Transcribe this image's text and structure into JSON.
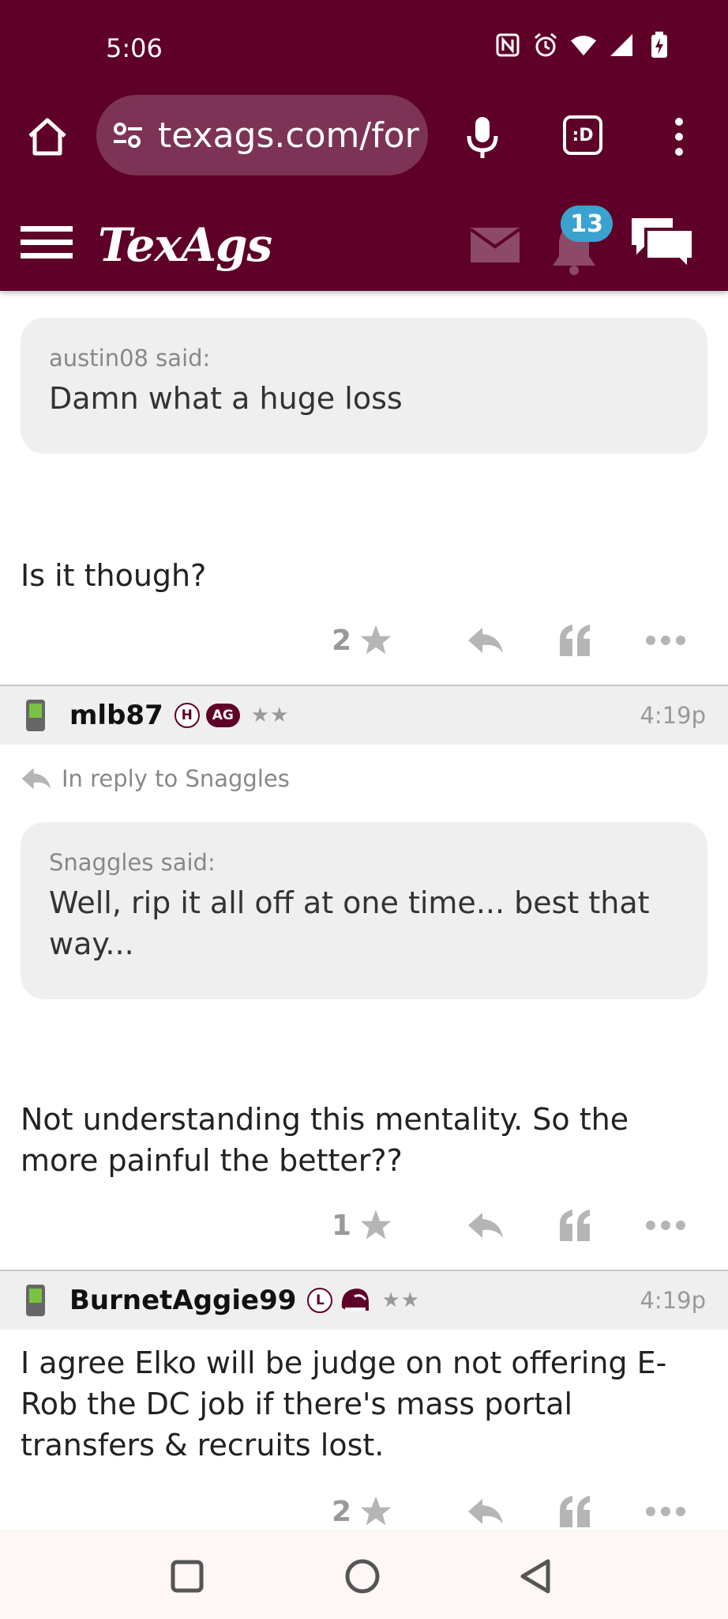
{
  "status_bar": {
    "time": "5:06",
    "icons": [
      "nfc-icon",
      "alarm-icon",
      "wifi-icon",
      "signal-icon",
      "battery-charging-icon"
    ]
  },
  "browser": {
    "url": "texags.com/for",
    "tab_switcher_label": ":D"
  },
  "site_header": {
    "logo": "TexAgs",
    "notification_count": "13",
    "colors": {
      "brand": "#5e0027",
      "badge": "#3ba2d0"
    }
  },
  "posts": [
    {
      "quote_author": "austin08 said:",
      "quote_text": "Damn what a huge loss",
      "body": "Is it though?",
      "likes": "2"
    },
    {
      "username": "mlb87",
      "badges": [
        "H",
        "AG"
      ],
      "stars": "★★",
      "time": "4:19p",
      "reply_to": "In reply to Snaggles",
      "quote_author": "Snaggles said:",
      "quote_text": "Well, rip it all off at one time... best that way...",
      "body": "Not understanding this mentality. So the more painful the better??",
      "likes": "1"
    },
    {
      "username": "BurnetAggie99",
      "badges": [
        "L"
      ],
      "stars": "★★",
      "time": "4:19p",
      "body": "I agree Elko will be judge on not offering E-Rob the DC job if there's mass portal transfers & recruits lost.",
      "likes": "2"
    }
  ]
}
